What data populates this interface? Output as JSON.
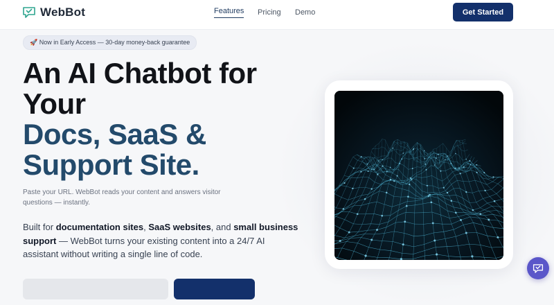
{
  "brand": {
    "name": "WebBot",
    "logo_icon": "chat-check-icon"
  },
  "nav": {
    "links": [
      {
        "label": "Features",
        "active": true
      },
      {
        "label": "Pricing",
        "active": false
      },
      {
        "label": "Demo",
        "active": false
      }
    ],
    "cta_label": "Get Started"
  },
  "hero": {
    "badge": "🚀 Now in Early Access — 30-day money-back guarantee",
    "headline_dark": [
      "An AI Chatbot for",
      "Your"
    ],
    "headline_accent": [
      "Docs, SaaS &",
      "Support Site."
    ],
    "subtext": "Paste your URL. WebBot reads your content and answers visitor questions — instantly.",
    "para": {
      "p1": "Built for ",
      "b1": "documentation sites",
      "p2": ", ",
      "b2": "SaaS websites",
      "p3": ", and ",
      "b3": "small business support",
      "p4": " — WebBot turns your existing content into a 24/7 AI assistant without writing a single line of code."
    }
  },
  "chat_widget": {
    "icon": "chat-bubble-icon"
  },
  "colors": {
    "primary": "#13306b",
    "accent_text": "#234a6b",
    "fab": "#5a56c9",
    "logo": "#2fa58f"
  }
}
